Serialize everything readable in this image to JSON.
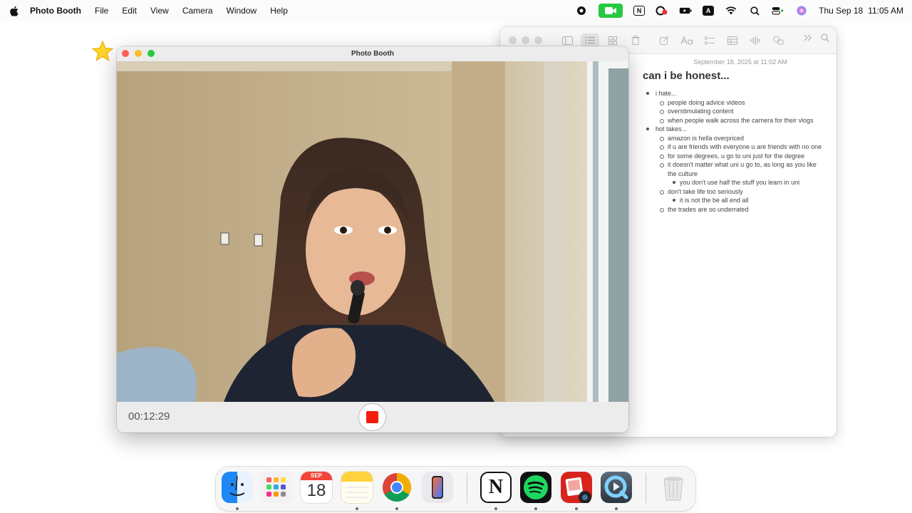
{
  "menubar": {
    "app_name": "Photo Booth",
    "menus": [
      "File",
      "Edit",
      "View",
      "Camera",
      "Window",
      "Help"
    ],
    "clock_date": "Thu Sep 18",
    "clock_time": "11:05 AM",
    "status_icons": [
      "record-indicator-icon",
      "facetime-video-icon",
      "notion-icon",
      "creative-cloud-icon",
      "battery-icon",
      "input-source-icon",
      "wifi-icon",
      "search-icon",
      "control-center-icon",
      "siri-icon"
    ],
    "input_source_letter": "A",
    "notion_letter": "N"
  },
  "photobooth": {
    "title": "Photo Booth",
    "timer": "00:12:29",
    "traffic_colors": {
      "close": "#fe5f57",
      "minimize": "#febc2e",
      "zoom": "#28c840"
    },
    "record_color": "#f41c0e"
  },
  "notes": {
    "date": "September 18, 2025 at 11:02 AM",
    "title": "can i be honest...",
    "items": [
      {
        "level": 1,
        "text": "i hate..."
      },
      {
        "level": 2,
        "text": "people doing advice videos"
      },
      {
        "level": 2,
        "text": "overstimulating content"
      },
      {
        "level": 2,
        "text": "when people walk across the camera for their vlogs"
      },
      {
        "level": 1,
        "text": "hot takes..."
      },
      {
        "level": 2,
        "text": "amazon is hella overpriced"
      },
      {
        "level": 2,
        "text": "if u are friends with everyone u are friends with no one"
      },
      {
        "level": 2,
        "text": "for some degrees, u go to uni just for the degree"
      },
      {
        "level": 2,
        "text": "it doesn't matter what uni u go to, as long as you like the culture"
      },
      {
        "level": 3,
        "text": "you don't use half the stuff you learn in uni"
      },
      {
        "level": 2,
        "text": "don't take life too seriously"
      },
      {
        "level": 3,
        "text": "it is not the be all end all"
      },
      {
        "level": 2,
        "text": "the trades are so underrated"
      }
    ]
  },
  "dock": {
    "apps": [
      "finder",
      "launchpad",
      "calendar",
      "notes",
      "chrome",
      "iphone-mirroring",
      "notion",
      "spotify",
      "photo-booth",
      "quicktime",
      "trash"
    ],
    "calendar_month": "SEP",
    "calendar_day": "18",
    "notion_letter": "N"
  }
}
